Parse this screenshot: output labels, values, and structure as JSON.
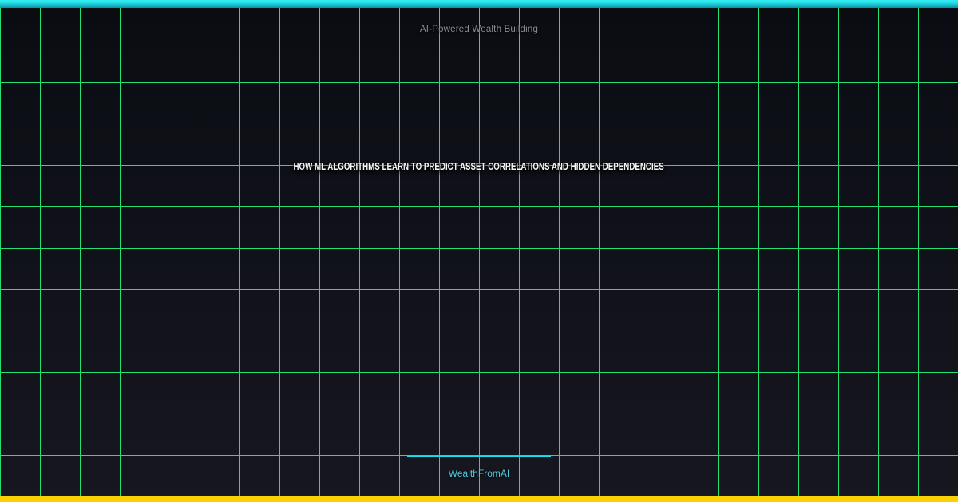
{
  "card": {
    "kicker": "AI-Powered Wealth Building",
    "title": "HOW ML ALGORITHMS LEARN TO PREDICT ASSET CORRELATIONS AND HIDDEN DEPENDENCIES",
    "brand": "WealthFromAI"
  },
  "colors": {
    "grid_green": "#21e174",
    "top_bar_cyan": "#27dfe9",
    "bottom_bar_gold": "#fbd104",
    "divider_cyan": "#17e0ee",
    "brand_cyan": "#54c8de",
    "kicker_gray": "#878d94",
    "title_white": "#f3f5f7",
    "background_top": "#0a0c12",
    "background_bottom": "#16171f"
  }
}
